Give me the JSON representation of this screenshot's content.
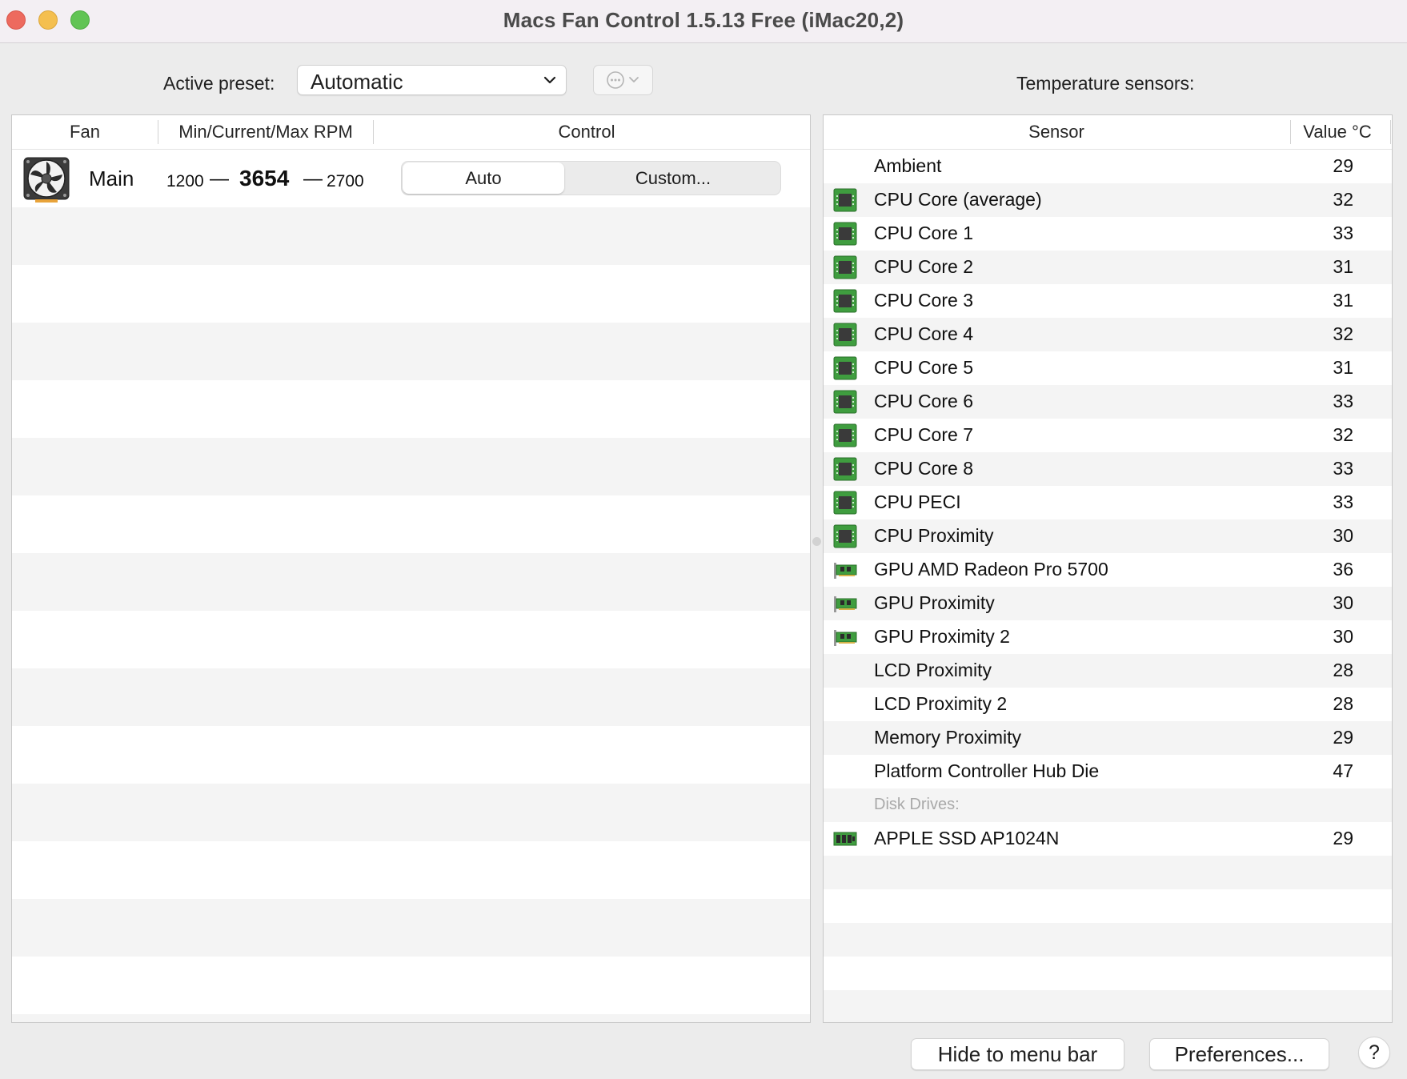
{
  "window": {
    "title": "Macs Fan Control 1.5.13 Free (iMac20,2)"
  },
  "toolbar": {
    "preset_label": "Active preset:",
    "preset_value": "Automatic",
    "sensors_title": "Temperature sensors:"
  },
  "fan_table": {
    "columns": [
      "Fan",
      "Min/Current/Max RPM",
      "Control"
    ],
    "rows": [
      {
        "name": "Main",
        "min_rpm": "1200",
        "current_rpm": "3654",
        "max_rpm": "2700",
        "separator": "—",
        "control_auto": "Auto",
        "control_custom": "Custom..."
      }
    ]
  },
  "sensor_table": {
    "columns": [
      "Sensor",
      "Value °C"
    ],
    "rows": [
      {
        "name": "Ambient",
        "value": "29",
        "icon": "none"
      },
      {
        "name": "CPU Core (average)",
        "value": "32",
        "icon": "cpu-chip-icon"
      },
      {
        "name": "CPU Core 1",
        "value": "33",
        "icon": "cpu-chip-icon"
      },
      {
        "name": "CPU Core 2",
        "value": "31",
        "icon": "cpu-chip-icon"
      },
      {
        "name": "CPU Core 3",
        "value": "31",
        "icon": "cpu-chip-icon"
      },
      {
        "name": "CPU Core 4",
        "value": "32",
        "icon": "cpu-chip-icon"
      },
      {
        "name": "CPU Core 5",
        "value": "31",
        "icon": "cpu-chip-icon"
      },
      {
        "name": "CPU Core 6",
        "value": "33",
        "icon": "cpu-chip-icon"
      },
      {
        "name": "CPU Core 7",
        "value": "32",
        "icon": "cpu-chip-icon"
      },
      {
        "name": "CPU Core 8",
        "value": "33",
        "icon": "cpu-chip-icon"
      },
      {
        "name": "CPU PECI",
        "value": "33",
        "icon": "cpu-chip-icon"
      },
      {
        "name": "CPU Proximity",
        "value": "30",
        "icon": "cpu-chip-icon"
      },
      {
        "name": "GPU AMD Radeon Pro 5700",
        "value": "36",
        "icon": "gpu-card-icon"
      },
      {
        "name": "GPU Proximity",
        "value": "30",
        "icon": "gpu-card-icon"
      },
      {
        "name": "GPU Proximity 2",
        "value": "30",
        "icon": "gpu-card-icon"
      },
      {
        "name": "LCD Proximity",
        "value": "28",
        "icon": "none"
      },
      {
        "name": "LCD Proximity 2",
        "value": "28",
        "icon": "none"
      },
      {
        "name": "Memory Proximity",
        "value": "29",
        "icon": "none"
      },
      {
        "name": "Platform Controller Hub Die",
        "value": "47",
        "icon": "none"
      }
    ],
    "group_label": "Disk Drives:",
    "disk_rows": [
      {
        "name": "APPLE SSD AP1024N",
        "value": "29",
        "icon": "ssd-drive-icon"
      }
    ]
  },
  "footer": {
    "hide_label": "Hide to menu bar",
    "preferences_label": "Preferences...",
    "help_label": "?"
  },
  "colors": {
    "close": "#ed6a5e",
    "minimize": "#f4bf4f",
    "maximize": "#61c454",
    "chip_green": "#3f9d3f"
  }
}
